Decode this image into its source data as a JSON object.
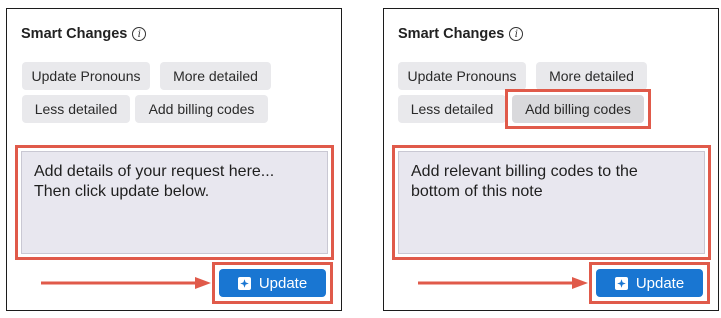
{
  "left": {
    "title": "Smart Changes",
    "chips": [
      "Update Pronouns",
      "More detailed",
      "Less detailed",
      "Add billing codes"
    ],
    "textarea_text": "Add details of your request here...\nThen click update below.",
    "button_label": "Update"
  },
  "right": {
    "title": "Smart Changes",
    "chips": [
      "Update Pronouns",
      "More detailed",
      "Less detailed",
      "Add billing codes"
    ],
    "selected_chip": "Add billing codes",
    "textarea_text": "Add relevant billing codes to the\nbottom of this note",
    "button_label": "Update"
  },
  "colors": {
    "highlight": "#e05a4a",
    "button": "#1976d2",
    "chip_bg": "#e9e9ec",
    "textarea_bg": "#e8e7ef"
  },
  "icons": {
    "info": "info-icon",
    "update": "sparkle-edit-icon"
  }
}
